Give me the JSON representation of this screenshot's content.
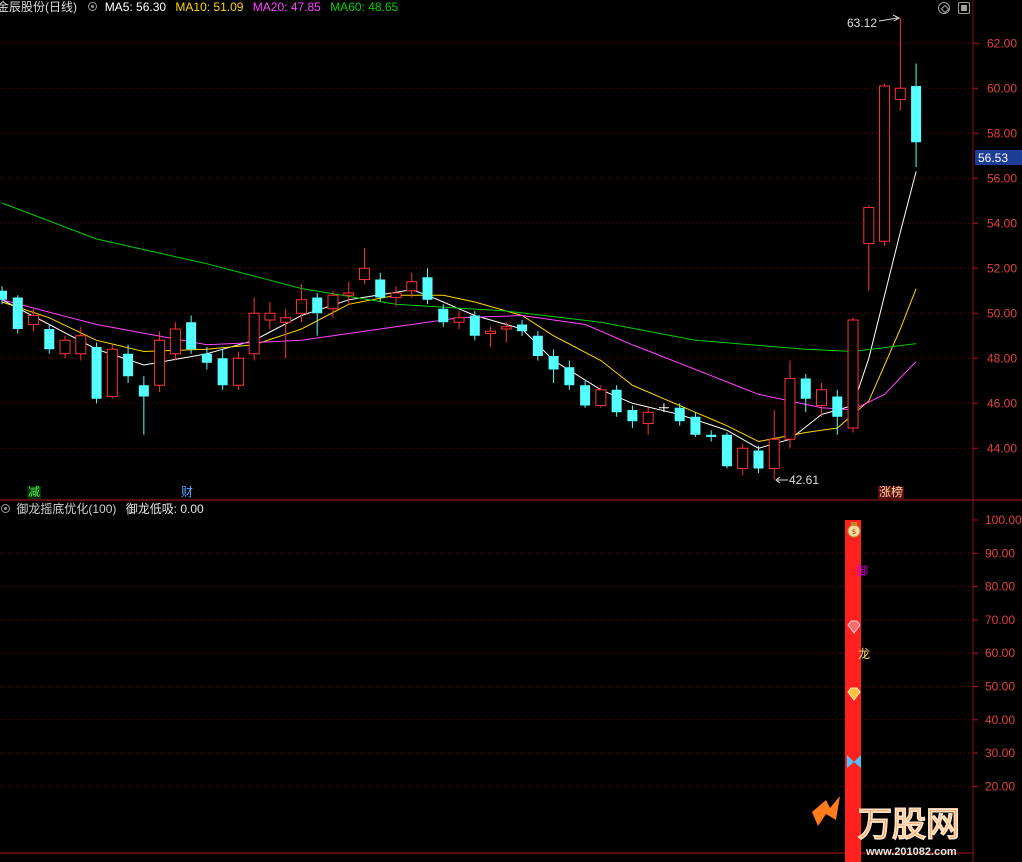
{
  "price_tags": {
    "high": "63.12",
    "low": "42.61",
    "last": "56.53"
  },
  "markers": {
    "jian": "减",
    "cai": "财",
    "zhangbang": "涨榜"
  },
  "lower_header": {
    "value_label": "御龙低吸: 0.00"
  },
  "signal_labels": {
    "yu": "御",
    "long": "龙"
  },
  "icons": {
    "header": "indicator-settings-icon",
    "toolbar": [
      "diamond-icon",
      "restore-icon"
    ],
    "signal": [
      "money-bag-icon",
      "ruby-gem-icon",
      "gold-gem-icon",
      "butterfly-icon"
    ]
  },
  "logo": {
    "name": "万股网",
    "url": "www.201082.com"
  },
  "colors": {
    "up": "#ff3232",
    "down": "#54ffff",
    "flat": "#ffffff",
    "ma5": "#ffffff",
    "ma10": "#ffd500",
    "ma20": "#ff44ff",
    "ma60": "#00cc00",
    "signal_bar": "#ff2020",
    "last_price_tag": "#1e3d96",
    "axis": "#e04040"
  },
  "chart_data": [
    {
      "type": "candlestick",
      "title": "金辰股份(日线)",
      "legend": [
        "MA5: 56.30",
        "MA10: 51.09",
        "MA20: 47.85",
        "MA60: 48.65"
      ],
      "ylim": [
        41.7,
        63.3
      ],
      "yticks": [
        62,
        60,
        58,
        56,
        54,
        52,
        50,
        48,
        46,
        44
      ],
      "ytick_labels": [
        "62.00",
        "60.00",
        "58.00",
        "56.00",
        "54.00",
        "52.00",
        "50.00",
        "48.00",
        "46.00",
        "44.00"
      ],
      "grid": true,
      "ohlc_order": [
        "open",
        "high",
        "low",
        "close"
      ],
      "ohlc": [
        [
          51.0,
          51.2,
          50.4,
          50.6
        ],
        [
          50.7,
          50.8,
          49.1,
          49.3
        ],
        [
          49.5,
          50.2,
          49.2,
          49.9
        ],
        [
          49.3,
          49.5,
          48.2,
          48.4
        ],
        [
          48.2,
          49.0,
          48.0,
          48.8
        ],
        [
          48.2,
          49.4,
          47.9,
          49.0
        ],
        [
          48.5,
          48.7,
          46.0,
          46.2
        ],
        [
          46.3,
          48.6,
          46.2,
          48.4
        ],
        [
          48.2,
          48.6,
          46.9,
          47.2
        ],
        [
          46.8,
          47.2,
          44.6,
          46.3
        ],
        [
          46.8,
          49.2,
          46.5,
          48.8
        ],
        [
          48.2,
          49.6,
          47.9,
          49.3
        ],
        [
          49.6,
          49.9,
          48.2,
          48.4
        ],
        [
          48.2,
          48.5,
          47.5,
          47.8
        ],
        [
          48.0,
          48.4,
          46.6,
          46.8
        ],
        [
          46.8,
          48.3,
          46.6,
          48.0
        ],
        [
          48.2,
          50.7,
          47.9,
          50.0
        ],
        [
          49.7,
          50.5,
          49.3,
          50.0
        ],
        [
          49.6,
          50.2,
          48.0,
          49.8
        ],
        [
          50.0,
          51.3,
          49.6,
          50.6
        ],
        [
          50.7,
          50.9,
          49.0,
          50.0
        ],
        [
          50.2,
          51.0,
          49.8,
          50.8
        ],
        [
          50.8,
          51.4,
          50.4,
          50.9
        ],
        [
          51.5,
          52.9,
          51.3,
          52.0
        ],
        [
          51.5,
          51.8,
          50.5,
          50.7
        ],
        [
          50.7,
          51.2,
          50.3,
          50.9
        ],
        [
          51.0,
          51.8,
          50.7,
          51.4
        ],
        [
          51.6,
          52.0,
          50.4,
          50.6
        ],
        [
          50.2,
          50.4,
          49.4,
          49.6
        ],
        [
          49.6,
          50.1,
          49.3,
          49.8
        ],
        [
          49.9,
          50.1,
          48.8,
          49.0
        ],
        [
          49.1,
          49.4,
          48.5,
          49.2
        ],
        [
          49.3,
          49.6,
          48.7,
          49.4
        ],
        [
          49.5,
          49.7,
          49.0,
          49.2
        ],
        [
          49.0,
          49.2,
          47.9,
          48.1
        ],
        [
          48.1,
          48.4,
          46.9,
          47.5
        ],
        [
          47.6,
          47.9,
          46.6,
          46.8
        ],
        [
          46.8,
          47.0,
          45.8,
          45.9
        ],
        [
          45.9,
          46.8,
          45.8,
          46.6
        ],
        [
          46.6,
          46.8,
          45.4,
          45.6
        ],
        [
          45.7,
          45.9,
          44.9,
          45.2
        ],
        [
          45.1,
          45.8,
          44.6,
          45.6
        ],
        [
          45.8,
          46.0,
          45.6,
          45.8
        ],
        [
          45.8,
          46.0,
          45.0,
          45.2
        ],
        [
          45.4,
          45.6,
          44.5,
          44.6
        ],
        [
          44.6,
          44.8,
          44.3,
          44.5
        ],
        [
          44.6,
          44.7,
          43.1,
          43.2
        ],
        [
          43.1,
          44.2,
          42.8,
          44.0
        ],
        [
          43.9,
          44.1,
          42.9,
          43.1
        ],
        [
          43.1,
          45.7,
          42.61,
          44.4
        ],
        [
          44.4,
          47.9,
          44.0,
          47.1
        ],
        [
          47.1,
          47.3,
          45.6,
          46.2
        ],
        [
          45.9,
          46.9,
          45.4,
          46.6
        ],
        [
          46.3,
          46.6,
          44.6,
          45.4
        ],
        [
          44.9,
          49.8,
          44.7,
          49.7
        ],
        [
          53.1,
          54.8,
          51.0,
          54.7
        ],
        [
          53.2,
          60.2,
          53.0,
          60.1
        ],
        [
          59.5,
          63.12,
          59.0,
          60.0
        ],
        [
          60.1,
          61.1,
          56.5,
          57.6
        ]
      ],
      "series": [
        {
          "name": "MA5",
          "color": "#ffffff",
          "points": [
            [
              0,
              50.6
            ],
            [
              6,
              48.4
            ],
            [
              9,
              47.7
            ],
            [
              13,
              48.2
            ],
            [
              16,
              48.8
            ],
            [
              19,
              49.9
            ],
            [
              22,
              50.6
            ],
            [
              26,
              51.05
            ],
            [
              27,
              50.8
            ],
            [
              30,
              49.9
            ],
            [
              33,
              49.3
            ],
            [
              35,
              47.9
            ],
            [
              38,
              46.6
            ],
            [
              40,
              46.0
            ],
            [
              43,
              45.5
            ],
            [
              46,
              44.8
            ],
            [
              48,
              44.0
            ],
            [
              50,
              44.4
            ],
            [
              52,
              45.5
            ],
            [
              54,
              45.9
            ],
            [
              55,
              48.0
            ],
            [
              56,
              50.8
            ],
            [
              57,
              53.6
            ],
            [
              58,
              56.3
            ]
          ]
        },
        {
          "name": "MA10",
          "color": "#ffd500",
          "points": [
            [
              0,
              50.5
            ],
            [
              3,
              49.8
            ],
            [
              6,
              48.8
            ],
            [
              9,
              48.3
            ],
            [
              13,
              48.4
            ],
            [
              16,
              48.6
            ],
            [
              19,
              49.3
            ],
            [
              22,
              50.4
            ],
            [
              25,
              50.8
            ],
            [
              28,
              50.8
            ],
            [
              30,
              50.5
            ],
            [
              33,
              49.9
            ],
            [
              35,
              49.0
            ],
            [
              38,
              47.9
            ],
            [
              40,
              46.8
            ],
            [
              43,
              45.9
            ],
            [
              46,
              45.0
            ],
            [
              48,
              44.3
            ],
            [
              51,
              44.7
            ],
            [
              53,
              44.9
            ],
            [
              55,
              46.1
            ],
            [
              57,
              49.3
            ],
            [
              58,
              51.09
            ]
          ]
        },
        {
          "name": "MA20",
          "color": "#ff44ff",
          "points": [
            [
              0,
              50.6
            ],
            [
              6,
              49.5
            ],
            [
              13,
              48.6
            ],
            [
              19,
              48.8
            ],
            [
              24,
              49.3
            ],
            [
              29,
              49.8
            ],
            [
              33,
              49.9
            ],
            [
              37,
              49.5
            ],
            [
              40,
              48.6
            ],
            [
              44,
              47.5
            ],
            [
              48,
              46.4
            ],
            [
              52,
              45.8
            ],
            [
              54,
              45.7
            ],
            [
              56,
              46.4
            ],
            [
              58,
              47.85
            ]
          ]
        },
        {
          "name": "MA60",
          "color": "#00cc00",
          "points": [
            [
              0,
              54.9
            ],
            [
              6,
              53.3
            ],
            [
              13,
              52.2
            ],
            [
              19,
              51.1
            ],
            [
              25,
              50.4
            ],
            [
              32,
              50.1
            ],
            [
              38,
              49.6
            ],
            [
              44,
              48.8
            ],
            [
              51,
              48.4
            ],
            [
              54,
              48.3
            ],
            [
              58,
              48.65
            ]
          ]
        }
      ]
    },
    {
      "type": "bar",
      "title": "御龙摇底优化(100)",
      "ylim": [
        0,
        106
      ],
      "yticks": [
        100,
        90,
        80,
        70,
        60,
        50,
        40,
        30,
        20
      ],
      "ytick_labels": [
        "100.00",
        "90.00",
        "80.00",
        "70.00",
        "60.00",
        "50.00",
        "40.00",
        "30.00",
        "20.00"
      ],
      "grid": true,
      "series": [
        {
          "name": "御龙低吸",
          "color": "#ff2020",
          "values": [
            0,
            0,
            0,
            0,
            0,
            0,
            0,
            0,
            0,
            0,
            0,
            0,
            0,
            0,
            0,
            0,
            0,
            0,
            0,
            0,
            0,
            0,
            0,
            0,
            0,
            0,
            0,
            0,
            0,
            0,
            0,
            0,
            0,
            0,
            0,
            0,
            0,
            0,
            0,
            0,
            0,
            0,
            0,
            0,
            0,
            0,
            0,
            0,
            0,
            0,
            0,
            0,
            0,
            0,
            100,
            0,
            0,
            0,
            0
          ]
        }
      ]
    }
  ]
}
